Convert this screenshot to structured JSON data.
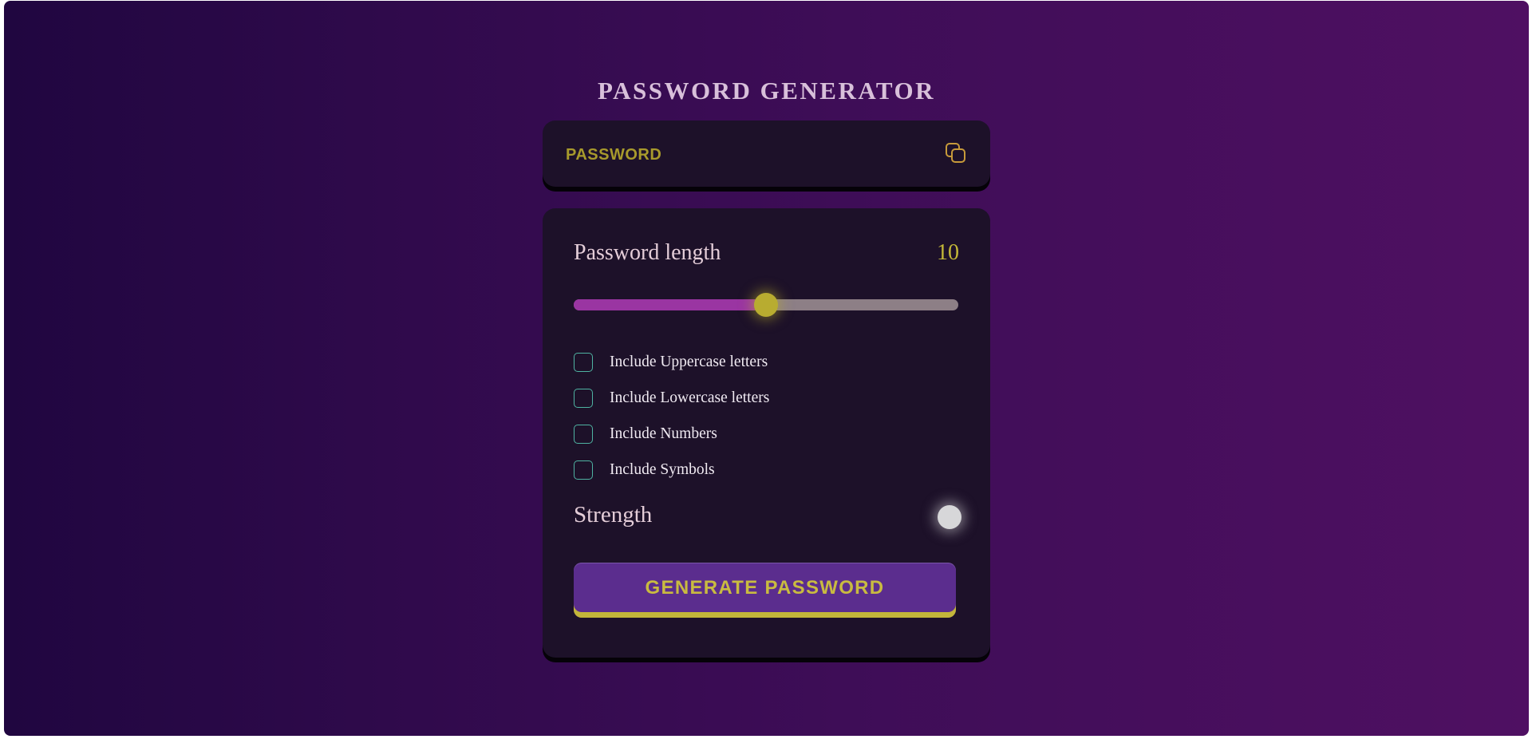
{
  "app": {
    "title": "PASSWORD GENERATOR"
  },
  "display": {
    "placeholder": "PASSWORD",
    "value": "",
    "copy_icon": "copy-icon"
  },
  "length": {
    "label": "Password length",
    "value": "10",
    "slider_fraction": 0.5
  },
  "options": [
    {
      "label": "Include Uppercase letters",
      "checked": false
    },
    {
      "label": "Include Lowercase letters",
      "checked": false
    },
    {
      "label": "Include Numbers",
      "checked": false
    },
    {
      "label": "Include Symbols",
      "checked": false
    }
  ],
  "strength": {
    "label": "Strength",
    "indicator_color": "#d7d7d9"
  },
  "actions": {
    "generate_label": "GENERATE PASSWORD"
  },
  "colors": {
    "background_start": "#200640",
    "background_end": "#4f1062",
    "card": "#1d1129",
    "accent_yellow": "#c4b838",
    "slider_fill": "#9a35a2",
    "checkbox_border": "#4fb3a2",
    "button": "#5b2d8e"
  }
}
